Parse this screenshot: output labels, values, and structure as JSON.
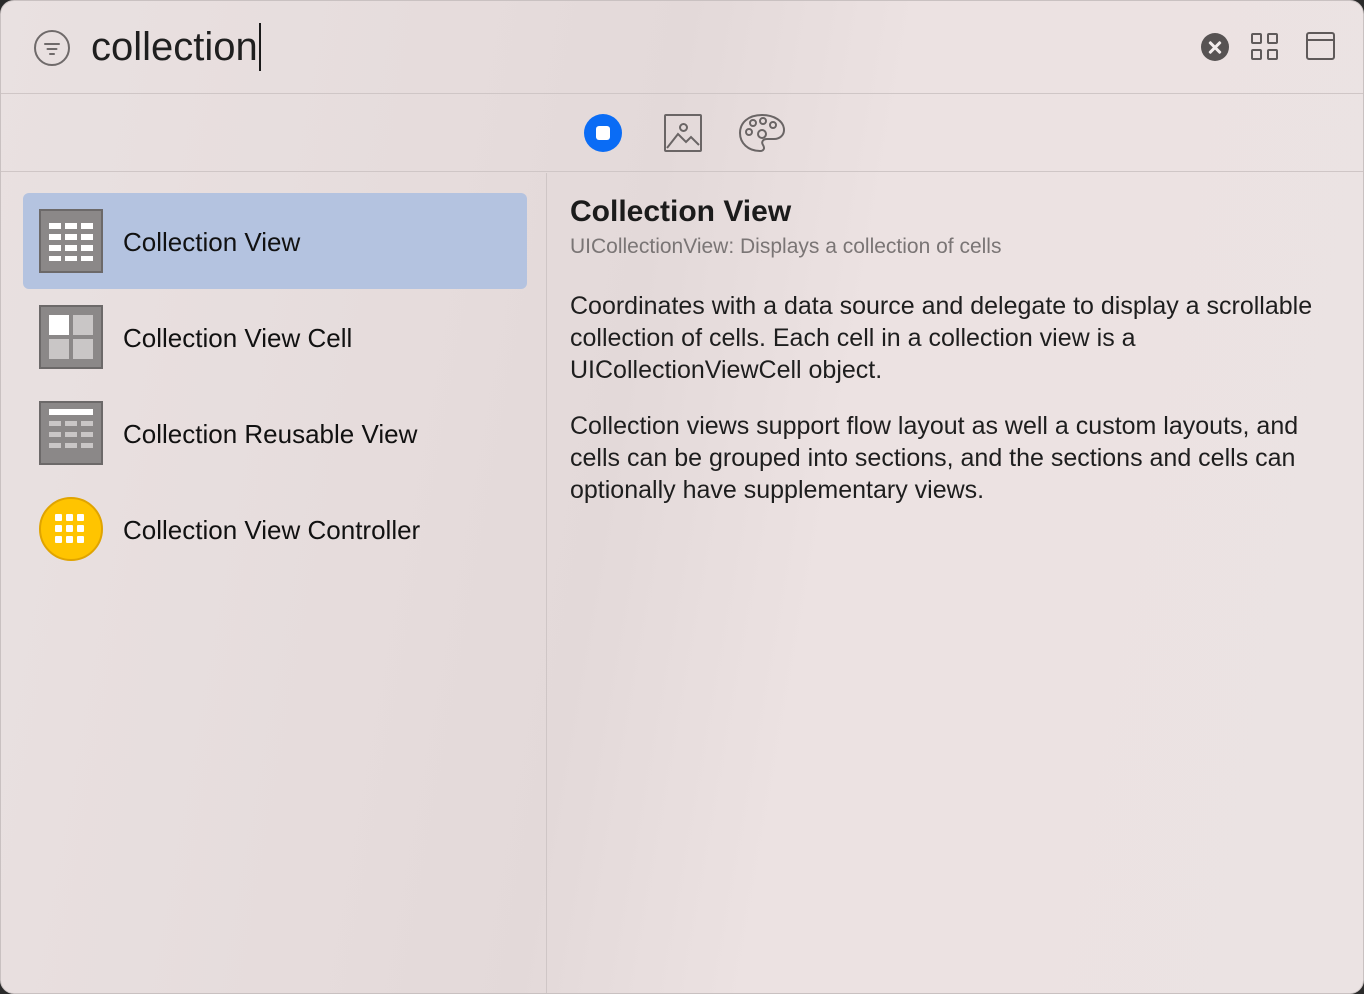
{
  "search": {
    "query": "collection"
  },
  "segments": [
    {
      "name": "objects",
      "icon": "square-in-circle-icon",
      "active": true
    },
    {
      "name": "media",
      "icon": "image-icon",
      "active": false
    },
    {
      "name": "colors",
      "icon": "palette-icon",
      "active": false
    }
  ],
  "list": {
    "items": [
      {
        "label": "Collection View",
        "icon": "collection-view-icon",
        "selected": true
      },
      {
        "label": "Collection View Cell",
        "icon": "collection-view-cell-icon",
        "selected": false
      },
      {
        "label": "Collection Reusable View",
        "icon": "collection-reusable-view-icon",
        "selected": false
      },
      {
        "label": "Collection View Controller",
        "icon": "collection-view-controller-icon",
        "selected": false
      }
    ]
  },
  "detail": {
    "title": "Collection View",
    "subtitle": "UICollectionView: Displays a collection of cells",
    "paragraph1": "Coordinates with a data source and delegate to display a scrollable collection of cells. Each cell in a collection view is a UICollectionViewCell object.",
    "paragraph2": "Collection views support flow layout as well a custom layouts, and cells can be grouped into sections, and the sections and cells can optionally have supplementary views."
  },
  "colors": {
    "accent": "#0a6cf5",
    "selection": "#b4c3e0",
    "controller_icon": "#ffc400"
  }
}
